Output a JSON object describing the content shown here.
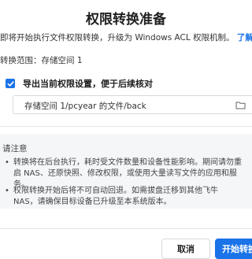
{
  "dialog": {
    "title": "权限转换准备",
    "description": "即将开始执行文件权限转换，升级为 Windows ACL 权限机制。",
    "details_link": "了解详情 >",
    "scope": "转换范围：存储空间 1"
  },
  "export": {
    "checked": true,
    "label": "导出当前权限设置，便于后续核对",
    "path_value": "存储空间 1/pcyear 的文件/back"
  },
  "notice": {
    "title": "请注意",
    "bullets": [
      "转换将在后台执行，耗时受文件数量和设备性能影响。期间请勿重启 NAS、还原快照、修改权限，或使用大量读写文件的应用和服务。",
      "权限转换开始后将不可自动回退。如需拔盘迁移到其他飞牛 NAS，请确保目标设备已升级至本系统版本。"
    ]
  },
  "footer": {
    "cancel_label": "取消",
    "start_label": "开始转换"
  },
  "colors": {
    "accent": "#1a73e8",
    "notice_bg": "#f5f6f8"
  },
  "icons": {
    "checkbox": "check-icon",
    "path": "folder-icon"
  }
}
